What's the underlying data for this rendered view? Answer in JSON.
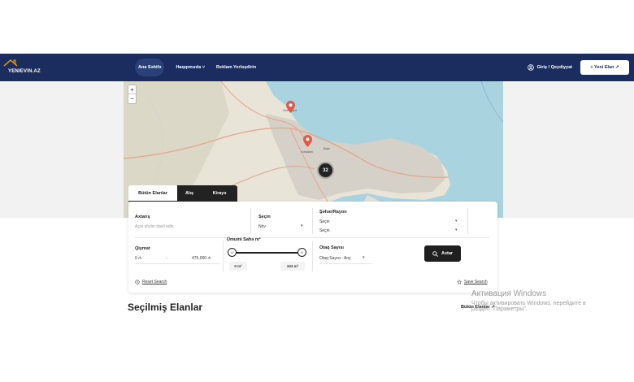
{
  "header": {
    "logo_text": "YENIEVIN.AZ",
    "nav": [
      {
        "label": "Ana Səhifə"
      },
      {
        "label": "Haqqımızda ˅"
      },
      {
        "label": "Reklam Yerləşdirin"
      }
    ],
    "login_label": "Giriş / Qeydiyyat",
    "new_ad_label": "+ Yeni Elan ↗"
  },
  "map": {
    "zoom_in": "+",
    "zoom_out": "−",
    "cluster_count": "32",
    "labels": [
      "Sumqayıt",
      "Xırdalan",
      "Bakı"
    ]
  },
  "search": {
    "tabs": [
      "Bütün Elanlar",
      "Alış",
      "Kirayə"
    ],
    "keyword": {
      "label": "Axtarış",
      "placeholder": "Açar sözlər daxil edin"
    },
    "choose": {
      "label": "Seçin",
      "value": "Növ"
    },
    "city": {
      "label": "Şəhər/Rayon",
      "value1": "Seçin",
      "value2": "Seçin"
    },
    "price": {
      "label": "Qiymət",
      "min": "0 ₼",
      "dash": "-",
      "max": "475,000 ₼"
    },
    "area": {
      "label": "Ümumi Sahə m²",
      "min": "0 m²",
      "max": "343 m²"
    },
    "rooms": {
      "label": "Otaq Sayısı",
      "value": "Otaq Sayısı : Any"
    },
    "search_button": "Axtar",
    "reset_label": "Reset Search",
    "save_label": "Save Search"
  },
  "featured": {
    "title": "Seçilmiş Elanlar",
    "all_link": "Bütün Elanlar ↗"
  },
  "watermark": {
    "line1": "Активация Windows",
    "line2": "Чтобы активировать Windows, перейдите в",
    "line3": "раздел \"Параметры\"."
  }
}
